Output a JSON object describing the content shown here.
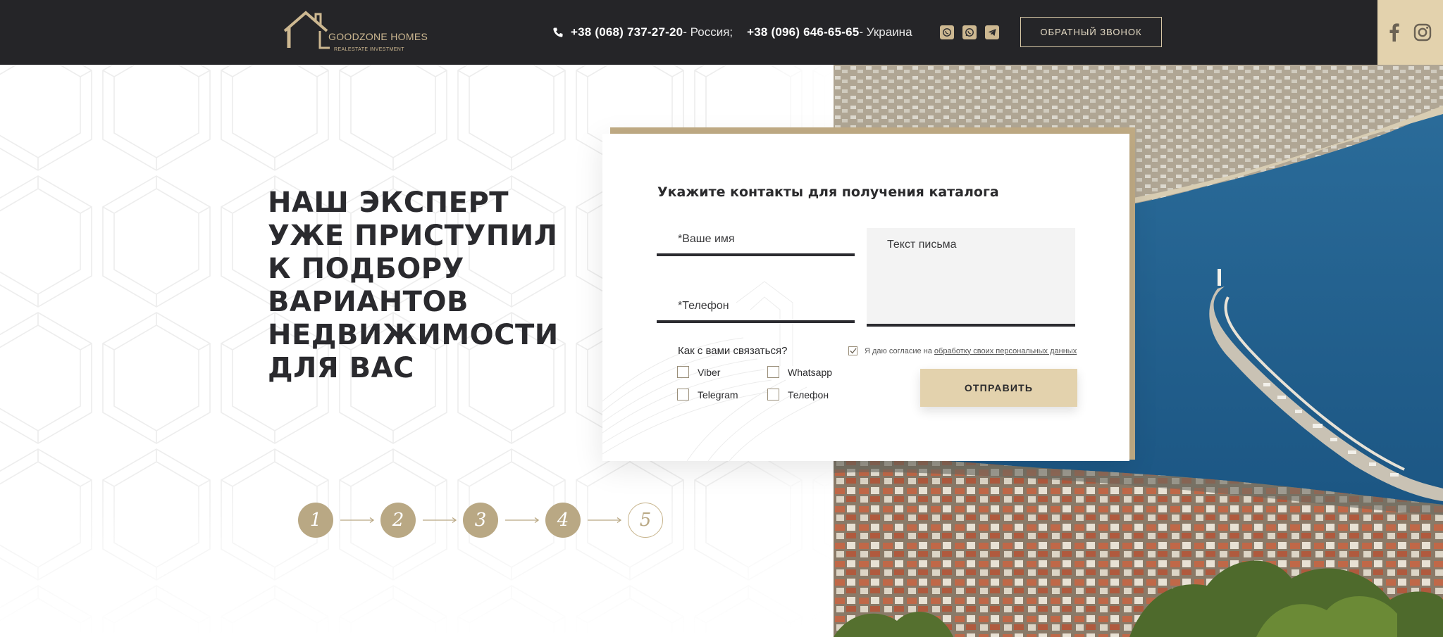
{
  "header": {
    "logo": {
      "name": "GOODZONE HOMES",
      "tagline": "REALESTATE INVESTMENT"
    },
    "phones": [
      {
        "number": "+38 (068) 737-27-20",
        "suffix": " - Россия;"
      },
      {
        "number": "+38 (096) 646-65-65",
        "suffix": " - Украина"
      }
    ],
    "messengers": [
      "viber-icon",
      "whatsapp-icon",
      "telegram-icon"
    ],
    "callback_button": "ОБРАТНЫЙ ЗВОНОК",
    "social": [
      "facebook-icon",
      "instagram-icon"
    ]
  },
  "hero": {
    "headline_lines": [
      "НАШ ЭКСПЕРТ",
      "УЖЕ ПРИСТУПИЛ",
      "К ПОДБОРУ",
      "ВАРИАНТОВ",
      "НЕДВИЖИМОСТИ",
      "ДЛЯ ВАС"
    ]
  },
  "steps": {
    "items": [
      "1",
      "2",
      "3",
      "4",
      "5"
    ],
    "current": "5"
  },
  "form": {
    "title": "Укажите контакты для получения каталога",
    "name_placeholder": "*Ваше имя",
    "phone_placeholder": "*Телефон",
    "message_placeholder": "Текст письма",
    "contact_question": "Как с вами связаться?",
    "contact_options": [
      "Viber",
      "Whatsapp",
      "Telegram",
      "Телефон"
    ],
    "consent_text": "Я даю согласие на",
    "consent_link": "обработку своих персональных данных",
    "consent_checked": true,
    "submit_label": "ОТПРАВИТЬ"
  },
  "colors": {
    "header_bg": "#252528",
    "accent": "#e3d2ad",
    "gold_dark": "#b9a884",
    "text": "#2a2a2e"
  }
}
